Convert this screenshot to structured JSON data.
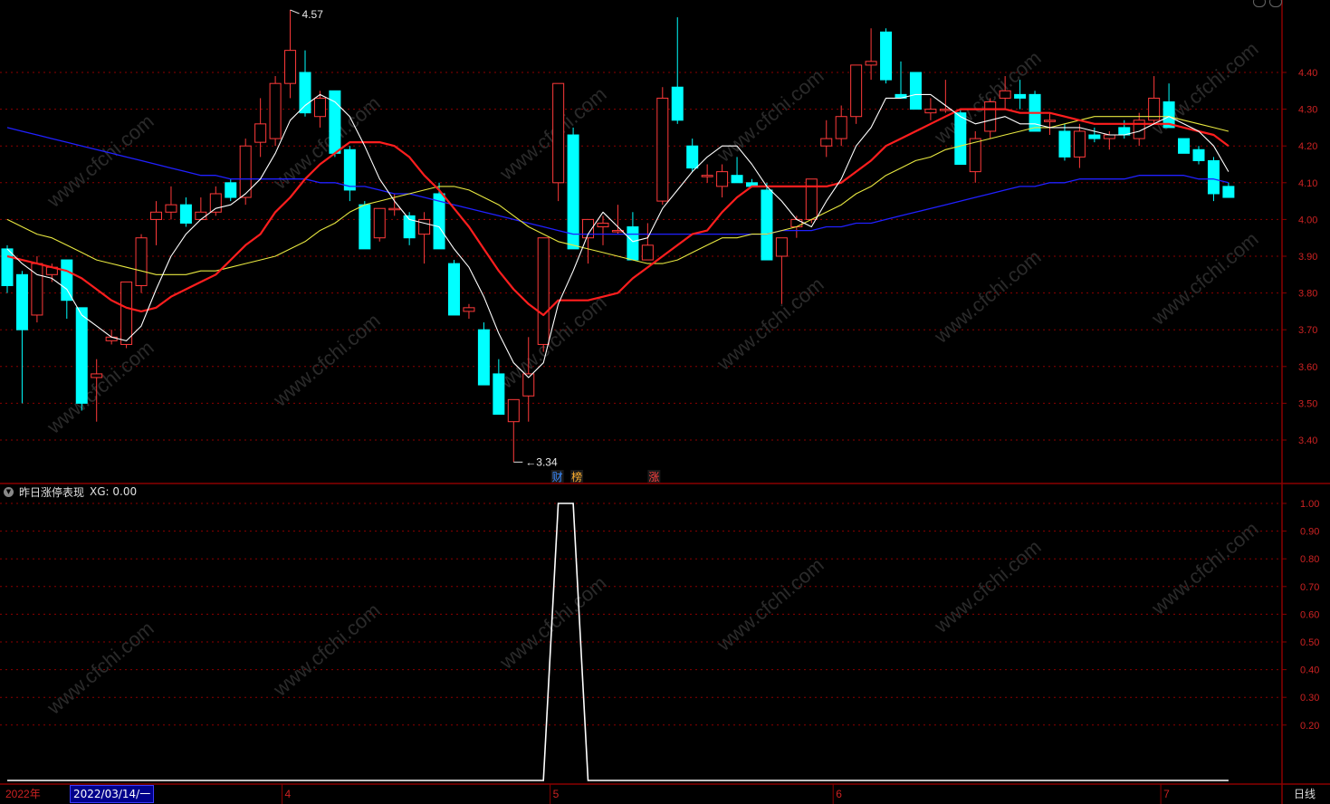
{
  "indicator": {
    "name": "昨日涨停表现",
    "xg_text": "XG: 0.00"
  },
  "period_tab": "日线",
  "cursor_date": "2022/03/14/一",
  "watermark_text": "www.cfchi.com",
  "price_axis_labels": [
    "4.40",
    "4.30",
    "4.20",
    "4.10",
    "4.00",
    "3.90",
    "3.80",
    "3.70",
    "3.60",
    "3.50",
    "3.40"
  ],
  "indicator_axis_labels": [
    "1.00",
    "0.90",
    "0.80",
    "0.70",
    "0.60",
    "0.50",
    "0.40",
    "0.30",
    "0.20"
  ],
  "annotations": {
    "high": "4.57",
    "low": "3.34"
  },
  "event_markers": [
    {
      "text": "财",
      "color": "#3a8bff"
    },
    {
      "text": "榜",
      "color": "#ffb030"
    },
    {
      "text": "涨",
      "color": "#ff4040"
    }
  ],
  "time_labels": [
    "2022年",
    "4",
    "5",
    "6",
    "7"
  ],
  "colors": {
    "up": "#ff3a3a",
    "down": "#00ffff",
    "ma5": "#ffffff",
    "ma10": "#ff1e1e",
    "ma20": "#e8e840",
    "ma60": "#2020ff",
    "grid": "#8b0000",
    "axis_text": "#cc2222"
  },
  "chart_data": [
    {
      "type": "candlestick",
      "title": "",
      "y_range": [
        3.3,
        4.6
      ],
      "grid": true,
      "candles": [
        {
          "o": 3.92,
          "h": 3.93,
          "l": 3.8,
          "c": 3.82
        },
        {
          "o": 3.85,
          "h": 3.86,
          "l": 3.5,
          "c": 3.7
        },
        {
          "o": 3.74,
          "h": 3.9,
          "l": 3.72,
          "c": 3.88
        },
        {
          "o": 3.85,
          "h": 3.88,
          "l": 3.83,
          "c": 3.87
        },
        {
          "o": 3.89,
          "h": 3.89,
          "l": 3.73,
          "c": 3.78
        },
        {
          "o": 3.76,
          "h": 3.76,
          "l": 3.48,
          "c": 3.5
        },
        {
          "o": 3.57,
          "h": 3.62,
          "l": 3.45,
          "c": 3.58
        },
        {
          "o": 3.67,
          "h": 3.7,
          "l": 3.66,
          "c": 3.68
        },
        {
          "o": 3.66,
          "h": 3.83,
          "l": 3.65,
          "c": 3.83
        },
        {
          "o": 3.82,
          "h": 3.96,
          "l": 3.8,
          "c": 3.95
        },
        {
          "o": 4.0,
          "h": 4.05,
          "l": 3.93,
          "c": 4.02
        },
        {
          "o": 4.02,
          "h": 4.09,
          "l": 4.0,
          "c": 4.04
        },
        {
          "o": 4.04,
          "h": 4.06,
          "l": 3.98,
          "c": 3.99
        },
        {
          "o": 4.0,
          "h": 4.06,
          "l": 4.0,
          "c": 4.02
        },
        {
          "o": 4.02,
          "h": 4.09,
          "l": 4.01,
          "c": 4.07
        },
        {
          "o": 4.1,
          "h": 4.11,
          "l": 4.05,
          "c": 4.06
        },
        {
          "o": 4.06,
          "h": 4.22,
          "l": 4.04,
          "c": 4.2
        },
        {
          "o": 4.21,
          "h": 4.33,
          "l": 4.17,
          "c": 4.26
        },
        {
          "o": 4.22,
          "h": 4.39,
          "l": 4.2,
          "c": 4.37
        },
        {
          "o": 4.37,
          "h": 4.57,
          "l": 4.33,
          "c": 4.46
        },
        {
          "o": 4.4,
          "h": 4.46,
          "l": 4.28,
          "c": 4.29
        },
        {
          "o": 4.28,
          "h": 4.35,
          "l": 4.25,
          "c": 4.33
        },
        {
          "o": 4.35,
          "h": 4.35,
          "l": 4.17,
          "c": 4.18
        },
        {
          "o": 4.19,
          "h": 4.2,
          "l": 4.05,
          "c": 4.08
        },
        {
          "o": 4.04,
          "h": 4.05,
          "l": 3.92,
          "c": 3.92
        },
        {
          "o": 3.95,
          "h": 4.03,
          "l": 3.94,
          "c": 4.03
        },
        {
          "o": 4.03,
          "h": 4.07,
          "l": 4.01,
          "c": 4.03
        },
        {
          "o": 4.01,
          "h": 4.02,
          "l": 3.93,
          "c": 3.95
        },
        {
          "o": 3.96,
          "h": 4.02,
          "l": 3.88,
          "c": 4.0
        },
        {
          "o": 4.07,
          "h": 4.1,
          "l": 3.92,
          "c": 3.92
        },
        {
          "o": 3.88,
          "h": 3.89,
          "l": 3.74,
          "c": 3.74
        },
        {
          "o": 3.75,
          "h": 3.77,
          "l": 3.73,
          "c": 3.76
        },
        {
          "o": 3.7,
          "h": 3.72,
          "l": 3.55,
          "c": 3.55
        },
        {
          "o": 3.58,
          "h": 3.62,
          "l": 3.47,
          "c": 3.47
        },
        {
          "o": 3.45,
          "h": 3.51,
          "l": 3.34,
          "c": 3.51
        },
        {
          "o": 3.52,
          "h": 3.68,
          "l": 3.45,
          "c": 3.58
        },
        {
          "o": 3.66,
          "h": 3.95,
          "l": 3.64,
          "c": 3.95
        },
        {
          "o": 4.1,
          "h": 4.37,
          "l": 4.05,
          "c": 4.37
        },
        {
          "o": 4.23,
          "h": 4.25,
          "l": 3.92,
          "c": 3.92
        },
        {
          "o": 3.95,
          "h": 4.0,
          "l": 3.88,
          "c": 4.0
        },
        {
          "o": 3.98,
          "h": 4.01,
          "l": 3.93,
          "c": 3.99
        },
        {
          "o": 3.97,
          "h": 4.04,
          "l": 3.96,
          "c": 3.97
        },
        {
          "o": 3.98,
          "h": 4.02,
          "l": 3.89,
          "c": 3.89
        },
        {
          "o": 3.89,
          "h": 3.99,
          "l": 3.89,
          "c": 3.93
        },
        {
          "o": 4.05,
          "h": 4.36,
          "l": 4.04,
          "c": 4.33
        },
        {
          "o": 4.36,
          "h": 4.55,
          "l": 4.26,
          "c": 4.27
        },
        {
          "o": 4.2,
          "h": 4.22,
          "l": 4.13,
          "c": 4.14
        },
        {
          "o": 4.12,
          "h": 4.15,
          "l": 4.1,
          "c": 4.12
        },
        {
          "o": 4.09,
          "h": 4.15,
          "l": 4.06,
          "c": 4.13
        },
        {
          "o": 4.12,
          "h": 4.17,
          "l": 4.1,
          "c": 4.1
        },
        {
          "o": 4.1,
          "h": 4.11,
          "l": 4.09,
          "c": 4.09
        },
        {
          "o": 4.08,
          "h": 4.1,
          "l": 3.89,
          "c": 3.89
        },
        {
          "o": 3.9,
          "h": 3.95,
          "l": 3.77,
          "c": 3.95
        },
        {
          "o": 3.98,
          "h": 4.01,
          "l": 3.95,
          "c": 4.0
        },
        {
          "o": 4.0,
          "h": 4.11,
          "l": 3.99,
          "c": 4.11
        },
        {
          "o": 4.2,
          "h": 4.27,
          "l": 4.17,
          "c": 4.22
        },
        {
          "o": 4.22,
          "h": 4.31,
          "l": 4.2,
          "c": 4.28
        },
        {
          "o": 4.28,
          "h": 4.42,
          "l": 4.26,
          "c": 4.42
        },
        {
          "o": 4.42,
          "h": 4.52,
          "l": 4.38,
          "c": 4.43
        },
        {
          "o": 4.51,
          "h": 4.52,
          "l": 4.37,
          "c": 4.38
        },
        {
          "o": 4.34,
          "h": 4.43,
          "l": 4.33,
          "c": 4.33
        },
        {
          "o": 4.4,
          "h": 4.4,
          "l": 4.3,
          "c": 4.3
        },
        {
          "o": 4.29,
          "h": 4.33,
          "l": 4.27,
          "c": 4.3
        },
        {
          "o": 4.3,
          "h": 4.38,
          "l": 4.29,
          "c": 4.3
        },
        {
          "o": 4.29,
          "h": 4.3,
          "l": 4.15,
          "c": 4.15
        },
        {
          "o": 4.13,
          "h": 4.24,
          "l": 4.1,
          "c": 4.22
        },
        {
          "o": 4.24,
          "h": 4.33,
          "l": 4.22,
          "c": 4.32
        },
        {
          "o": 4.33,
          "h": 4.39,
          "l": 4.3,
          "c": 4.35
        },
        {
          "o": 4.34,
          "h": 4.38,
          "l": 4.3,
          "c": 4.33
        },
        {
          "o": 4.34,
          "h": 4.35,
          "l": 4.24,
          "c": 4.24
        },
        {
          "o": 4.27,
          "h": 4.29,
          "l": 4.23,
          "c": 4.27
        },
        {
          "o": 4.24,
          "h": 4.26,
          "l": 4.16,
          "c": 4.17
        },
        {
          "o": 4.17,
          "h": 4.26,
          "l": 4.14,
          "c": 4.24
        },
        {
          "o": 4.23,
          "h": 4.25,
          "l": 4.21,
          "c": 4.22
        },
        {
          "o": 4.22,
          "h": 4.24,
          "l": 4.19,
          "c": 4.23
        },
        {
          "o": 4.25,
          "h": 4.27,
          "l": 4.22,
          "c": 4.23
        },
        {
          "o": 4.22,
          "h": 4.29,
          "l": 4.2,
          "c": 4.27
        },
        {
          "o": 4.27,
          "h": 4.39,
          "l": 4.26,
          "c": 4.33
        },
        {
          "o": 4.32,
          "h": 4.37,
          "l": 4.25,
          "c": 4.25
        },
        {
          "o": 4.22,
          "h": 4.22,
          "l": 4.18,
          "c": 4.18
        },
        {
          "o": 4.19,
          "h": 4.2,
          "l": 4.15,
          "c": 4.16
        },
        {
          "o": 4.16,
          "h": 4.17,
          "l": 4.05,
          "c": 4.07
        },
        {
          "o": 4.09,
          "h": 4.1,
          "l": 4.06,
          "c": 4.06
        }
      ],
      "ma5": [
        3.92,
        3.88,
        3.85,
        3.84,
        3.81,
        3.74,
        3.71,
        3.68,
        3.67,
        3.71,
        3.81,
        3.9,
        3.96,
        4.0,
        4.03,
        4.04,
        4.07,
        4.11,
        4.18,
        4.27,
        4.31,
        4.34,
        4.32,
        4.28,
        4.2,
        4.11,
        4.05,
        4.0,
        3.99,
        3.98,
        3.92,
        3.87,
        3.79,
        3.69,
        3.61,
        3.57,
        3.61,
        3.77,
        3.86,
        3.96,
        4.02,
        3.98,
        3.94,
        3.95,
        4.03,
        4.08,
        4.13,
        4.17,
        4.2,
        4.2,
        4.15,
        4.09,
        4.05,
        4.0,
        3.98,
        4.05,
        4.11,
        4.2,
        4.25,
        4.33,
        4.33,
        4.34,
        4.34,
        4.31,
        4.28,
        4.26,
        4.27,
        4.28,
        4.26,
        4.26,
        4.25,
        4.25,
        4.25,
        4.24,
        4.23,
        4.23,
        4.24,
        4.26,
        4.28,
        4.26,
        4.24,
        4.2,
        4.13
      ],
      "ma10": [
        3.9,
        3.89,
        3.88,
        3.87,
        3.86,
        3.84,
        3.81,
        3.78,
        3.76,
        3.75,
        3.76,
        3.79,
        3.81,
        3.83,
        3.85,
        3.89,
        3.93,
        3.96,
        4.02,
        4.06,
        4.11,
        4.15,
        4.18,
        4.21,
        4.21,
        4.21,
        4.2,
        4.17,
        4.12,
        4.08,
        4.03,
        3.98,
        3.92,
        3.86,
        3.81,
        3.77,
        3.74,
        3.78,
        3.78,
        3.78,
        3.79,
        3.8,
        3.84,
        3.87,
        3.9,
        3.93,
        3.96,
        3.97,
        4.02,
        4.06,
        4.09,
        4.09,
        4.09,
        4.09,
        4.09,
        4.09,
        4.1,
        4.13,
        4.16,
        4.2,
        4.22,
        4.24,
        4.26,
        4.28,
        4.3,
        4.3,
        4.3,
        4.3,
        4.29,
        4.29,
        4.29,
        4.28,
        4.27,
        4.26,
        4.26,
        4.26,
        4.26,
        4.26,
        4.26,
        4.25,
        4.24,
        4.23,
        4.2
      ],
      "ma20": [
        4.0,
        3.98,
        3.96,
        3.95,
        3.93,
        3.91,
        3.89,
        3.88,
        3.87,
        3.86,
        3.85,
        3.85,
        3.85,
        3.86,
        3.86,
        3.87,
        3.88,
        3.89,
        3.9,
        3.92,
        3.94,
        3.97,
        3.99,
        4.02,
        4.04,
        4.05,
        4.06,
        4.07,
        4.08,
        4.09,
        4.09,
        4.08,
        4.06,
        4.04,
        4.01,
        3.98,
        3.96,
        3.94,
        3.93,
        3.92,
        3.91,
        3.9,
        3.89,
        3.88,
        3.88,
        3.89,
        3.91,
        3.93,
        3.95,
        3.95,
        3.96,
        3.96,
        3.97,
        3.98,
        4.0,
        4.02,
        4.04,
        4.07,
        4.09,
        4.12,
        4.14,
        4.16,
        4.17,
        4.19,
        4.2,
        4.21,
        4.22,
        4.23,
        4.24,
        4.25,
        4.25,
        4.26,
        4.27,
        4.28,
        4.28,
        4.28,
        4.28,
        4.28,
        4.28,
        4.27,
        4.26,
        4.25,
        4.24
      ],
      "ma60": [
        4.25,
        4.24,
        4.23,
        4.22,
        4.21,
        4.2,
        4.19,
        4.18,
        4.17,
        4.16,
        4.15,
        4.14,
        4.13,
        4.12,
        4.12,
        4.11,
        4.11,
        4.11,
        4.11,
        4.11,
        4.11,
        4.1,
        4.1,
        4.09,
        4.09,
        4.08,
        4.07,
        4.07,
        4.06,
        4.05,
        4.04,
        4.03,
        4.02,
        4.01,
        4.0,
        3.99,
        3.98,
        3.97,
        3.96,
        3.96,
        3.96,
        3.96,
        3.96,
        3.96,
        3.96,
        3.96,
        3.96,
        3.96,
        3.96,
        3.96,
        3.96,
        3.96,
        3.97,
        3.97,
        3.97,
        3.98,
        3.98,
        3.99,
        3.99,
        4.0,
        4.01,
        4.02,
        4.03,
        4.04,
        4.05,
        4.06,
        4.07,
        4.08,
        4.09,
        4.09,
        4.1,
        4.1,
        4.11,
        4.11,
        4.11,
        4.11,
        4.12,
        4.12,
        4.12,
        4.12,
        4.11,
        4.11,
        4.1
      ]
    },
    {
      "type": "line",
      "title": "昨日涨停表现",
      "y_range": [
        0,
        1.0
      ],
      "series": [
        {
          "name": "XG",
          "values": [
            0,
            0,
            0,
            0,
            0,
            0,
            0,
            0,
            0,
            0,
            0,
            0,
            0,
            0,
            0,
            0,
            0,
            0,
            0,
            0,
            0,
            0,
            0,
            0,
            0,
            0,
            0,
            0,
            0,
            0,
            0,
            0,
            0,
            0,
            0,
            0,
            0,
            1,
            1,
            0,
            0,
            0,
            0,
            0,
            0,
            0,
            0,
            0,
            0,
            0,
            0,
            0,
            0,
            0,
            0,
            0,
            0,
            0,
            0,
            0,
            0,
            0,
            0,
            0,
            0,
            0,
            0,
            0,
            0,
            0,
            0,
            0,
            0,
            0,
            0,
            0,
            0,
            0,
            0,
            0,
            0,
            0,
            0
          ]
        }
      ]
    }
  ]
}
